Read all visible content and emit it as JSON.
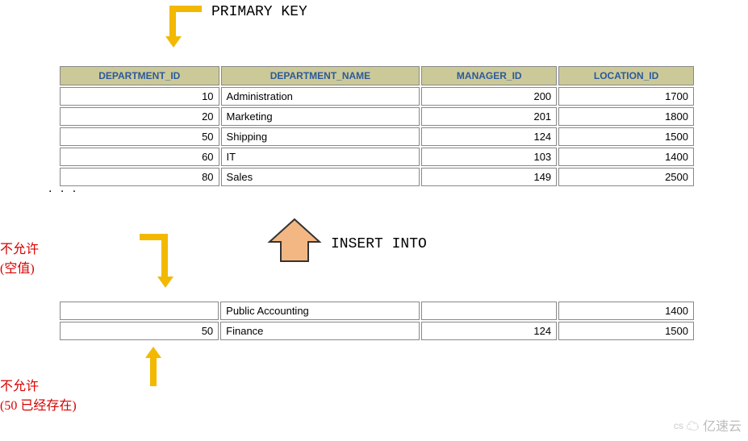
{
  "labels": {
    "primary_key": "PRIMARY KEY",
    "insert_into": "INSERT INTO",
    "not_allowed_null_l1": "不允许",
    "not_allowed_null_l2": "(空值)",
    "not_allowed_dup_l1": "不允许",
    "not_allowed_dup_l2": "(50 已经存在)",
    "ellipsis": ". . ."
  },
  "table": {
    "headers": [
      "DEPARTMENT_ID",
      "DEPARTMENT_NAME",
      "MANAGER_ID",
      "LOCATION_ID"
    ],
    "rows": [
      {
        "id": "10",
        "name": "Administration",
        "mgr": "200",
        "loc": "1700"
      },
      {
        "id": "20",
        "name": "Marketing",
        "mgr": "201",
        "loc": "1800"
      },
      {
        "id": "50",
        "name": "Shipping",
        "mgr": "124",
        "loc": "1500"
      },
      {
        "id": "60",
        "name": "IT",
        "mgr": "103",
        "loc": "1400"
      },
      {
        "id": "80",
        "name": "Sales",
        "mgr": "149",
        "loc": "2500"
      }
    ]
  },
  "insert_rows": [
    {
      "id": "",
      "name": "Public Accounting",
      "mgr": "",
      "loc": "1400"
    },
    {
      "id": "50",
      "name": "Finance",
      "mgr": "124",
      "loc": "1500"
    }
  ],
  "watermark": {
    "cs": "cs",
    "brand": "亿速云"
  },
  "chart_data": {
    "type": "table",
    "title": "PRIMARY KEY constraint illustration",
    "columns": [
      "DEPARTMENT_ID",
      "DEPARTMENT_NAME",
      "MANAGER_ID",
      "LOCATION_ID"
    ],
    "existing_rows": [
      [
        10,
        "Administration",
        200,
        1700
      ],
      [
        20,
        "Marketing",
        201,
        1800
      ],
      [
        50,
        "Shipping",
        124,
        1500
      ],
      [
        60,
        "IT",
        103,
        1400
      ],
      [
        80,
        "Sales",
        149,
        2500
      ]
    ],
    "attempted_inserts": [
      {
        "row": [
          null,
          "Public Accounting",
          null,
          1400
        ],
        "rejected_reason": "NULL primary key"
      },
      {
        "row": [
          50,
          "Finance",
          124,
          1500
        ],
        "rejected_reason": "Duplicate primary key (50 already exists)"
      }
    ],
    "primary_key_column": "DEPARTMENT_ID"
  }
}
